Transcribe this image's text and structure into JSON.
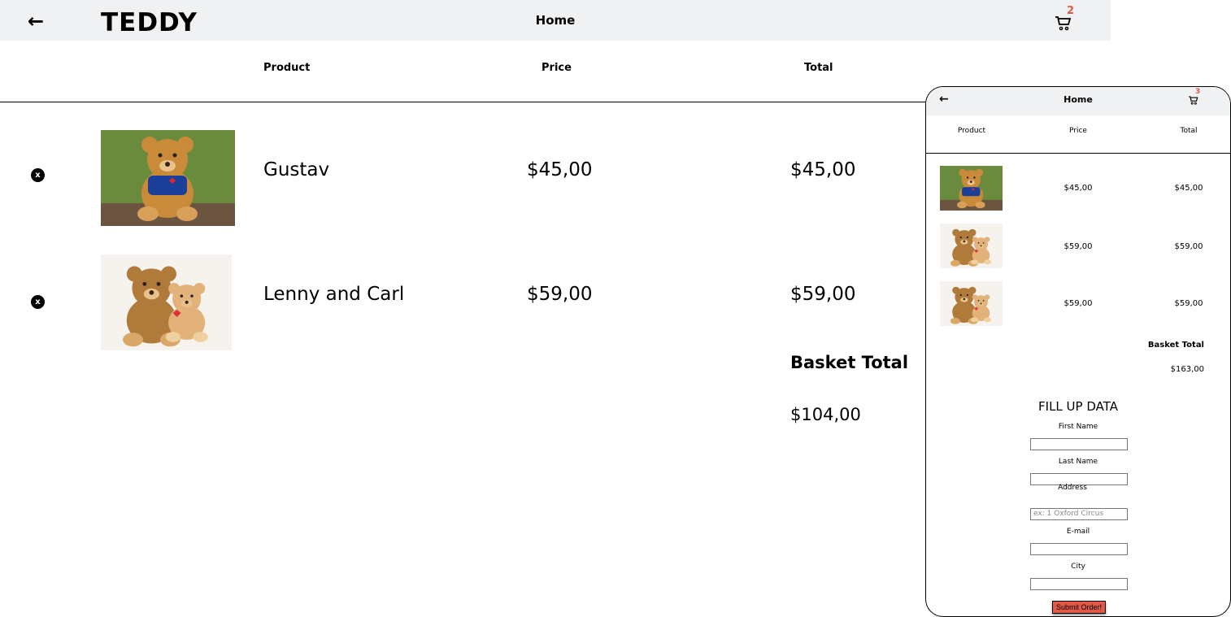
{
  "header": {
    "back_icon": "arrow-left-icon",
    "logo": "TEDDY",
    "title": "Home",
    "cart_icon": "cart-icon",
    "cart_count": "2"
  },
  "columns": {
    "product": "Product",
    "price": "Price",
    "total": "Total"
  },
  "items": [
    {
      "name": "Gustav",
      "price": "$45,00",
      "total": "$45,00",
      "remove": "x"
    },
    {
      "name": "Lenny and Carl",
      "price": "$59,00",
      "total": "$59,00",
      "remove": "x"
    }
  ],
  "basket": {
    "label": "Basket Total",
    "value": "$104,00"
  },
  "mobile": {
    "header": {
      "title": "Home",
      "cart_count": "3"
    },
    "columns": {
      "product": "Product",
      "price": "Price",
      "total": "Total"
    },
    "items": [
      {
        "price": "$45,00",
        "total": "$45,00"
      },
      {
        "price": "$59,00",
        "total": "$59,00"
      },
      {
        "price": "$59,00",
        "total": "$59,00"
      }
    ],
    "basket": {
      "label": "Basket Total",
      "value": "$163,00"
    },
    "form": {
      "title": "FILL UP DATA",
      "first_name": "First Name",
      "last_name": "Last Name",
      "address": "Address",
      "address_placeholder": "ex: 1 Oxford Circus",
      "email": "E-mail",
      "city": "City",
      "submit": "Submit Order!"
    }
  },
  "colors": {
    "badge": "#e8564a",
    "submit": "#e05a47",
    "header_bg": "#f0f1f3"
  }
}
